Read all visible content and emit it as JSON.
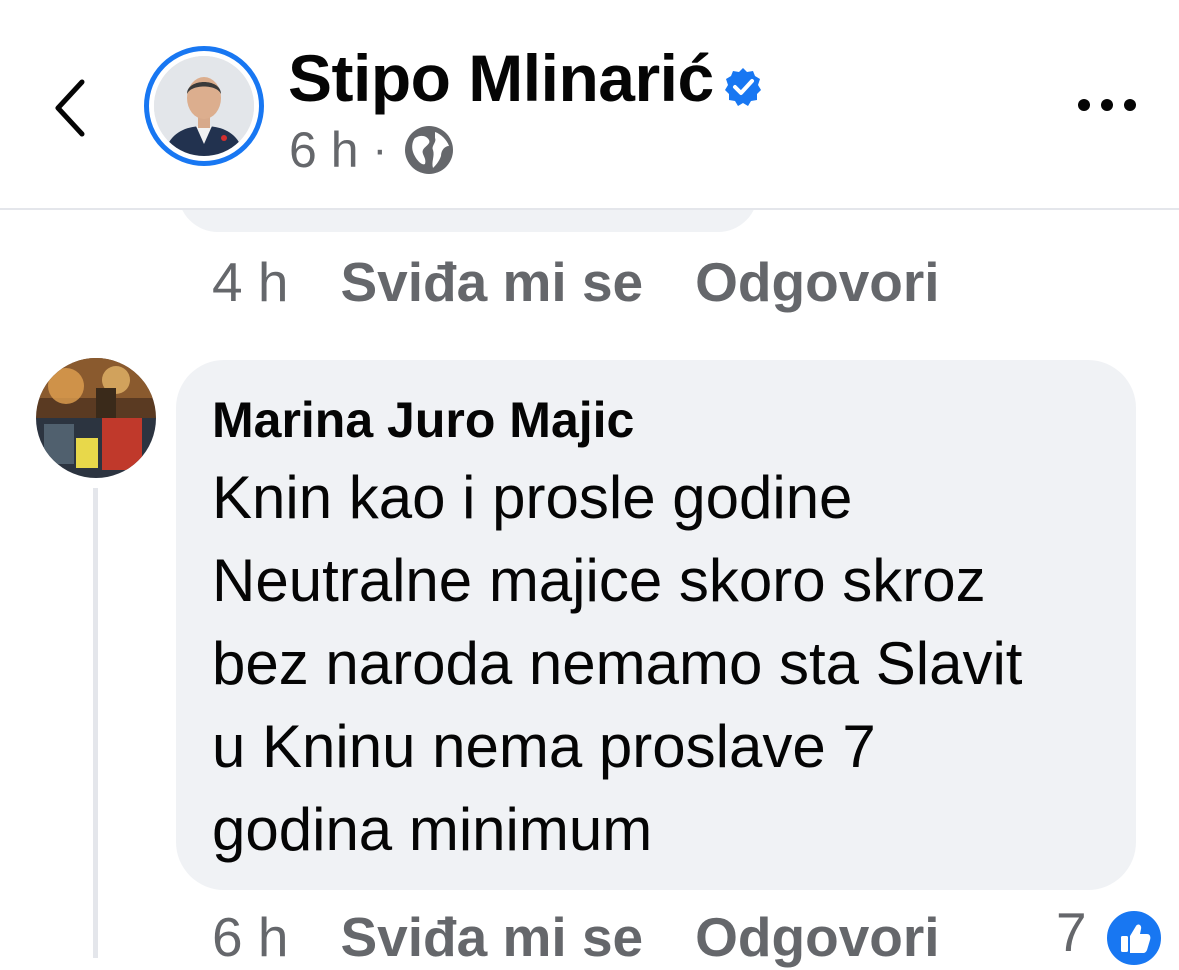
{
  "header": {
    "page_name": "Stipo Mlinarić",
    "post_time": "6 h",
    "separator": "·",
    "audience_icon": "globe-icon",
    "back_icon": "chevron-left-icon",
    "more_icon": "more-horizontal-icon"
  },
  "previous_comment": {
    "time": "4 h",
    "like_label": "Sviđa mi se",
    "reply_label": "Odgovori"
  },
  "comment": {
    "author": "Marina Juro Majic",
    "lines": [
      "Knin kao i prosle godine",
      "Neutralne majice skoro skroz",
      "bez naroda nemamo sta Slavit",
      "u Kninu nema proslave 7",
      "godina minimum"
    ],
    "time": "6 h",
    "like_label": "Sviđa mi se",
    "reply_label": "Odgovori",
    "reaction_count": "7",
    "reaction_icon": "like-icon"
  },
  "colors": {
    "accent": "#1877f2",
    "bubble": "#f0f2f5",
    "secondary_text": "#65676b"
  }
}
